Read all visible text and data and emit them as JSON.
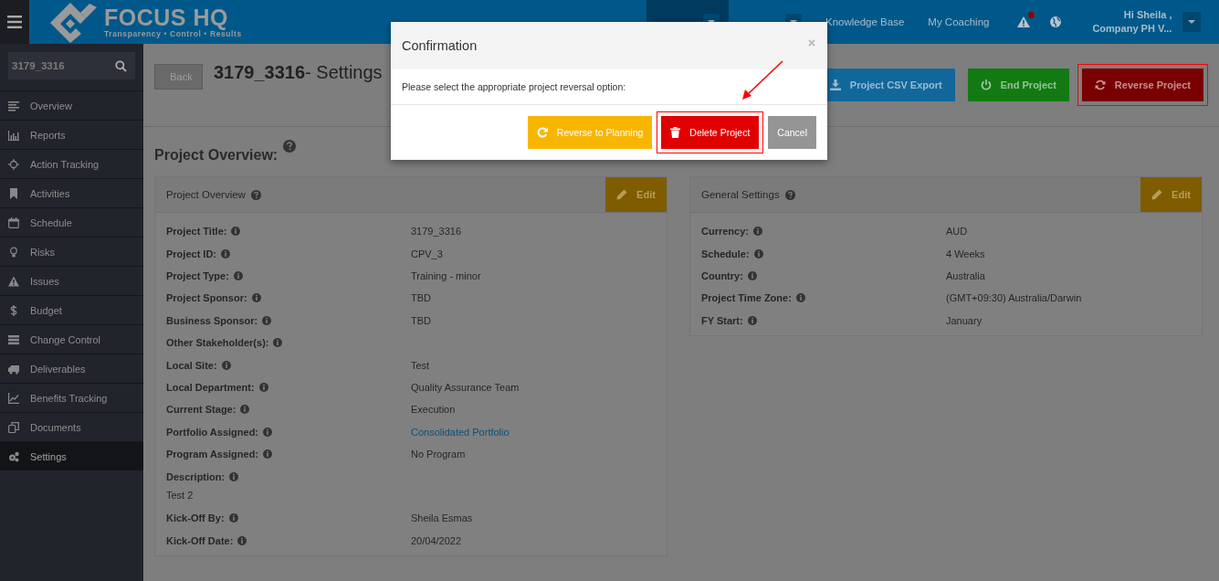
{
  "header": {
    "logo_name": "FOCUS HQ",
    "logo_tagline": "Transparency • Control • Results",
    "nav": [
      {
        "selected": false,
        "dropdown": false
      },
      {
        "selected": true,
        "dropdown": true
      },
      {
        "selected": false,
        "dropdown": true
      },
      {
        "label": "Knowledge Base",
        "selected": false,
        "dropdown": false
      },
      {
        "label": "My Coaching",
        "selected": false,
        "dropdown": false
      }
    ],
    "alert_unread": true,
    "user": {
      "greeting": "Hi Sheila ,",
      "company": "Company PH V..."
    }
  },
  "sidebar": {
    "search": {
      "value": "3179_3316"
    },
    "items": [
      {
        "label": "Overview",
        "selected": false
      },
      {
        "label": "Reports",
        "selected": false
      },
      {
        "label": "Action Tracking",
        "selected": false
      },
      {
        "label": "Activities",
        "selected": false
      },
      {
        "label": "Schedule",
        "selected": false
      },
      {
        "label": "Risks",
        "selected": false
      },
      {
        "label": "Issues",
        "selected": false
      },
      {
        "label": "Budget",
        "selected": false
      },
      {
        "label": "Change Control",
        "selected": false
      },
      {
        "label": "Deliverables",
        "selected": false
      },
      {
        "label": "Benefits Tracking",
        "selected": false
      },
      {
        "label": "Documents",
        "selected": false
      },
      {
        "label": "Settings",
        "selected": true
      }
    ]
  },
  "page": {
    "back_label": "Back",
    "title": "**3179_3316**- Settings",
    "actions": [
      {
        "label": "Project CSV Export",
        "kind": "export",
        "highlighted": false
      },
      {
        "label": "End Project",
        "kind": "end",
        "highlighted": false
      },
      {
        "label": "Reverse Project",
        "kind": "reverse",
        "highlighted": true
      }
    ],
    "section_heading": "Project Overview:",
    "cards": [
      {
        "title": "Project Overview",
        "edit_label": "Edit",
        "rows": [
          {
            "label": "Project Title:",
            "value": "3179_3316",
            "kind": "text"
          },
          {
            "label": "Project ID:",
            "value": "CPV_3",
            "kind": "text"
          },
          {
            "label": "Project Type:",
            "value": "Training - minor",
            "kind": "text"
          },
          {
            "label": "Project Sponsor:",
            "value": "TBD",
            "kind": "text"
          },
          {
            "label": "Business Sponsor:",
            "value": "TBD",
            "kind": "text"
          },
          {
            "label": "Other Stakeholder(s):",
            "kind": "text"
          },
          {
            "label": "Local Site:",
            "value": "Test",
            "kind": "text"
          },
          {
            "label": "Local Department:",
            "value": "Quality Assurance Team",
            "kind": "text"
          },
          {
            "label": "Current Stage:",
            "value": "Execution",
            "kind": "text"
          },
          {
            "label": "Portfolio Assigned:",
            "value": "Consolidated Portfolio",
            "kind": "link"
          },
          {
            "label": "Program Assigned:",
            "value": "No Program",
            "kind": "text"
          },
          {
            "label": "Description:",
            "value": "Test 2",
            "kind": "block"
          },
          {
            "label": "Kick-Off By:",
            "value": "Sheila Esmas",
            "kind": "text"
          },
          {
            "label": "Kick-Off Date:",
            "value": "20/04/2022",
            "kind": "text"
          }
        ]
      },
      {
        "title": "General Settings",
        "edit_label": "Edit",
        "rows": [
          {
            "label": "Currency:",
            "value": "AUD",
            "kind": "text"
          },
          {
            "label": "Schedule:",
            "value": "4 Weeks",
            "kind": "text"
          },
          {
            "label": "Country:",
            "value": "Australia",
            "kind": "text"
          },
          {
            "label": "Project Time Zone:",
            "value": "(GMT+09:30) Australia/Darwin",
            "kind": "text"
          },
          {
            "label": "FY Start:",
            "value": "January",
            "kind": "text"
          }
        ]
      }
    ]
  },
  "dialog": {
    "title": "Confirmation",
    "message": "Please select the appropriate project reversal option:",
    "buttons": [
      {
        "label": "Reverse to Planning",
        "kind": "planning",
        "highlighted": false
      },
      {
        "label": "Delete Project",
        "kind": "delete",
        "highlighted": true
      },
      {
        "label": "Cancel",
        "kind": "cancel",
        "highlighted": false
      }
    ]
  }
}
